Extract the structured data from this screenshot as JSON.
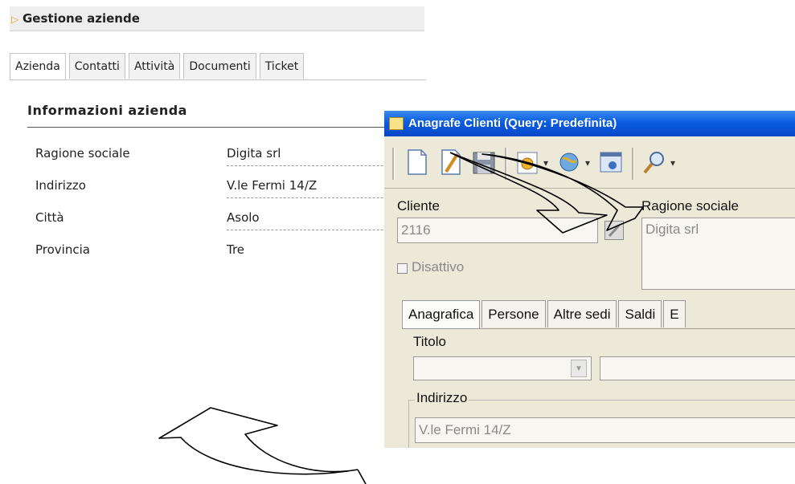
{
  "web": {
    "title": "Gestione aziende",
    "tabs": [
      "Azienda",
      "Contatti",
      "Attività",
      "Documenti",
      "Ticket"
    ],
    "section_title": "Informazioni azienda",
    "fields": [
      {
        "label": "Ragione sociale",
        "value": "Digita srl"
      },
      {
        "label": "Indirizzo",
        "value": "V.le Fermi 14/Z"
      },
      {
        "label": "Città",
        "value": "Asolo"
      },
      {
        "label": "Provincia",
        "value": "Tre"
      }
    ]
  },
  "win": {
    "title": "Anagrafe Clienti (Query: Predefinita)",
    "cliente_label": "Cliente",
    "cliente_value": "2116",
    "ragione_label": "Ragione sociale",
    "ragione_value": "Digita srl",
    "disattivo_label": "Disattivo",
    "tabs": [
      "Anagrafica",
      "Persone",
      "Altre sedi",
      "Saldi",
      "E"
    ],
    "titolo_label": "Titolo",
    "indirizzo_label": "Indirizzo",
    "indirizzo_value": "V.le Fermi 14/Z"
  },
  "icons": [
    "new-document-icon",
    "edit-document-icon",
    "save-icon",
    "properties-icon",
    "globe-icon",
    "settings-window-icon",
    "search-icon"
  ],
  "colors": {
    "titlebar": "#0a5ce0",
    "dialog_bg": "#ece9d8",
    "accent": "#f0a020"
  }
}
